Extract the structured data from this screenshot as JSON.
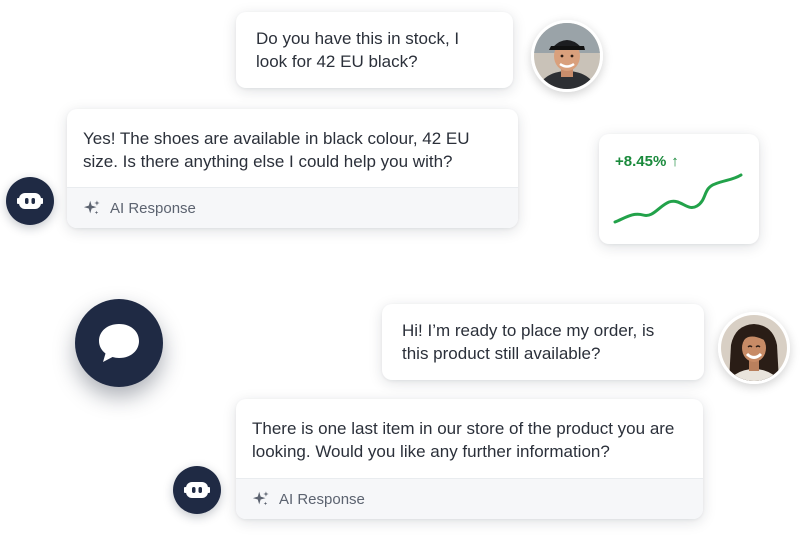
{
  "conversation_1": {
    "user_message": "Do you have this in stock, I look for 42 EU black?",
    "ai_message": "Yes! The shoes are available in black colour, 42 EU size. Is there anything else I could help you with?",
    "ai_label": "AI Response"
  },
  "stat_card": {
    "value": "+8.45%",
    "arrow": "↑",
    "trend_color": "#1a8a3c"
  },
  "conversation_2": {
    "user_message": "Hi! I’m ready to place my order, is this product still available?",
    "ai_message": "There is one last item in our store of the product you are looking. Would you like any further information?",
    "ai_label": "AI Response"
  },
  "icons": {
    "bot": "robot-icon",
    "chat": "chat-bubble-icon",
    "sparkle": "sparkle-icon",
    "trend": "trend-line-icon"
  },
  "colors": {
    "brand_navy": "#1f2a44",
    "positive_green": "#1a8a3c",
    "footer_bg": "#f6f7f9"
  }
}
